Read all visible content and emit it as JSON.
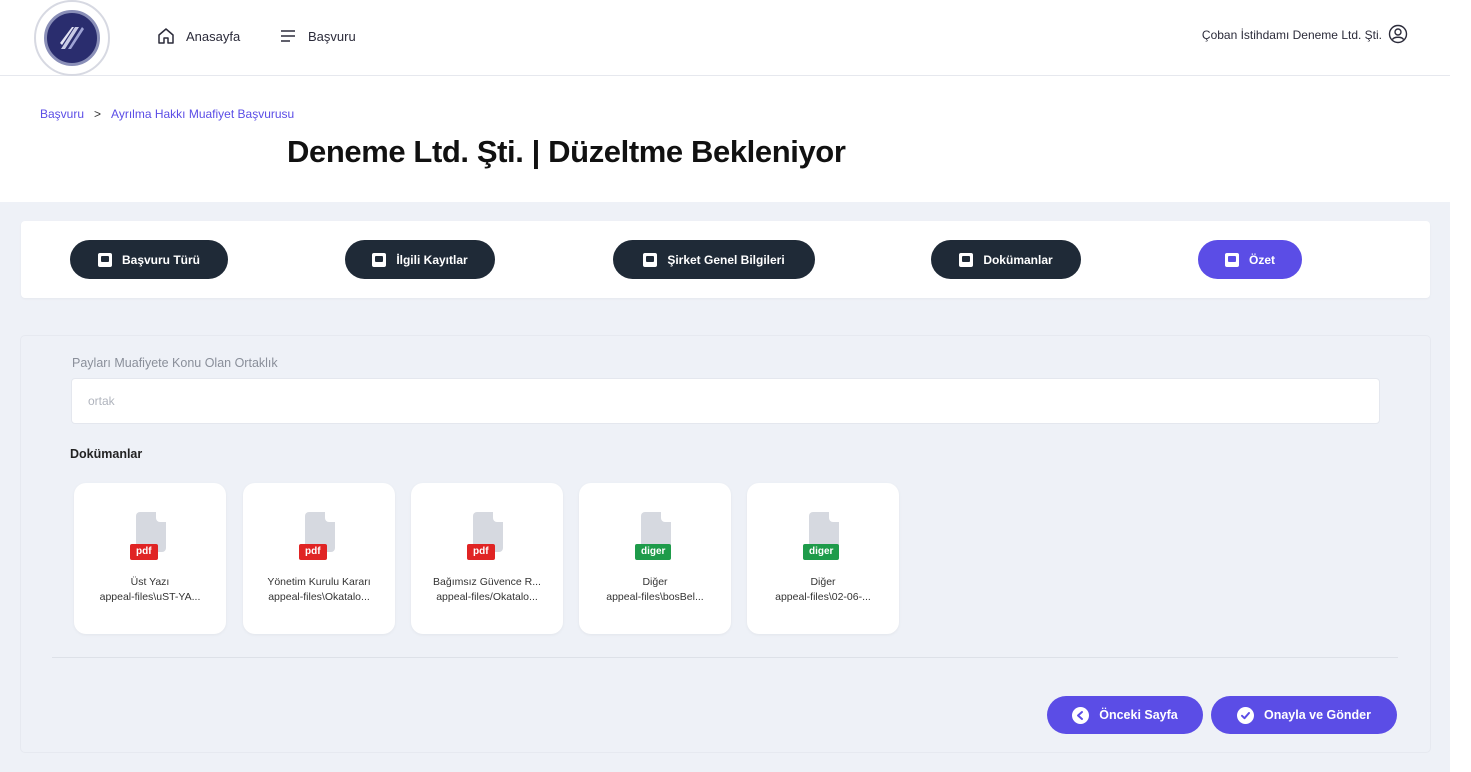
{
  "nav": {
    "home_label": "Anasayfa",
    "application_label": "Başvuru",
    "company_name": "Çoban İstihdamı Deneme Ltd. Şti."
  },
  "breadcrumb": {
    "root": "Başvuru",
    "separator": ">",
    "current": "Ayrılma Hakkı Muafiyet Başvurusu"
  },
  "page": {
    "title": "Deneme Ltd. Şti. | Düzeltme Bekleniyor"
  },
  "tabs": [
    {
      "label": "Başvuru Türü",
      "active": false
    },
    {
      "label": "İlgili Kayıtlar",
      "active": false
    },
    {
      "label": "Şirket Genel Bilgileri",
      "active": false
    },
    {
      "label": "Dokümanlar",
      "active": false
    },
    {
      "label": "Özet",
      "active": true
    }
  ],
  "summary": {
    "partnership_label": "Payları Muafiyete Konu Olan Ortaklık",
    "partnership_value": "ortak",
    "documents_heading": "Dokümanlar",
    "documents": [
      {
        "type": "pdf",
        "name": "Üst Yazı",
        "path": "appeal-files\\uST-YA..."
      },
      {
        "type": "pdf",
        "name": "Yönetim Kurulu Kararı",
        "path": "appeal-files\\Okatalo..."
      },
      {
        "type": "pdf",
        "name": "Bağımsız Güvence R...",
        "path": "appeal-files/Okatalo..."
      },
      {
        "type": "diger",
        "name": "Diğer",
        "path": "appeal-files\\bosBel..."
      },
      {
        "type": "diger",
        "name": "Diğer",
        "path": "appeal-files\\02-06-..."
      }
    ]
  },
  "actions": {
    "previous_label": "Önceki Sayfa",
    "submit_label": "Onayla ve Gönder"
  },
  "colors": {
    "accent": "#5b4de6",
    "tab_dark": "#1f2a37",
    "pdf_badge": "#e02424",
    "other_badge": "#1e9b4a",
    "content_bg": "#eef1f7"
  }
}
